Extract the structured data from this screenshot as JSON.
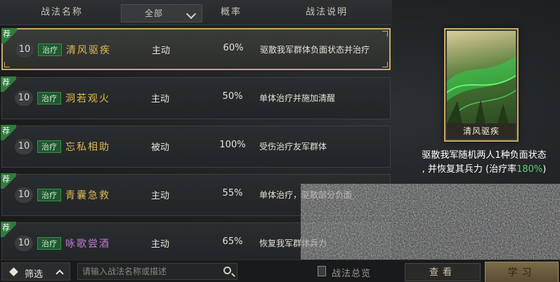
{
  "header": {
    "name_col": "战法名称",
    "type_filter": "全部",
    "rate_col": "概率",
    "desc_col": "战法说明"
  },
  "badge": "荐",
  "rows": [
    {
      "level": "10",
      "tag": "治疗",
      "name": "清风驱疾",
      "name_color": "#e0b851",
      "type": "主动",
      "rate": "60%",
      "desc": "驱散我军群体负面状态并治疗",
      "selected": true
    },
    {
      "level": "10",
      "tag": "治疗",
      "name": "洞若观火",
      "name_color": "#e0b851",
      "type": "主动",
      "rate": "50%",
      "desc": "单体治疗并施加清醒",
      "selected": false
    },
    {
      "level": "10",
      "tag": "治疗",
      "name": "忘私相助",
      "name_color": "#e0b851",
      "type": "被动",
      "rate": "100%",
      "desc": "受伤治疗友军群体",
      "selected": false
    },
    {
      "level": "10",
      "tag": "治疗",
      "name": "青囊急救",
      "name_color": "#e0b851",
      "type": "主动",
      "rate": "55%",
      "desc": "单体治疗，驱散部分负面",
      "selected": false
    },
    {
      "level": "10",
      "tag": "治疗",
      "name": "咏歌尝酒",
      "name_color": "#c07ad8",
      "type": "主动",
      "rate": "65%",
      "desc": "恢复我军群体兵力",
      "selected": false
    }
  ],
  "detail": {
    "card_label": "清风驱疾",
    "desc_line1": "驱散我军随机两人1种负面状态",
    "desc_line2_pre": ", 并恢复其兵力 (治疗率",
    "desc_highlight": "180%",
    "desc_line2_post": ")"
  },
  "bottom": {
    "filter_label": "筛选",
    "search_placeholder": "请输入战法名称或描述",
    "book_label": "战法总览",
    "view_label": "查看",
    "learn_label": "学习"
  }
}
